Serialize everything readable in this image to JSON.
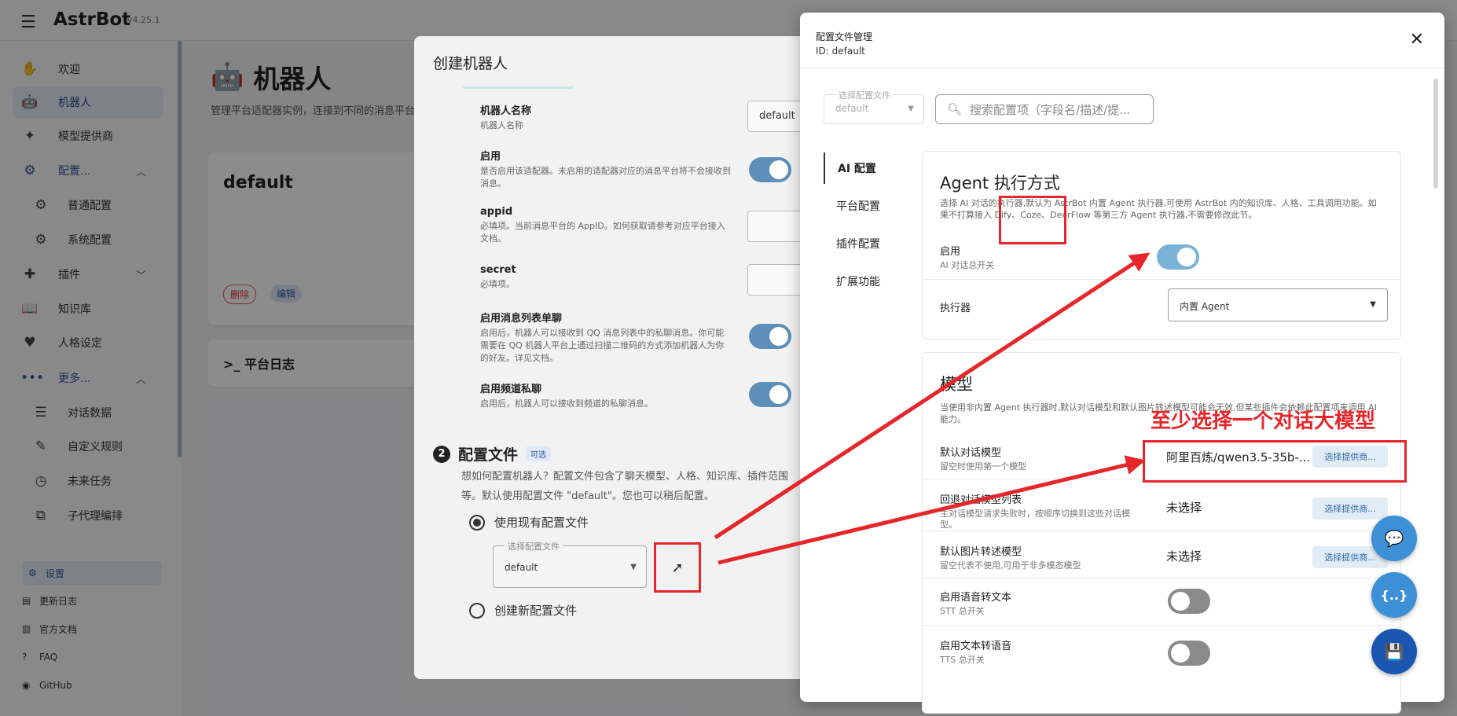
{
  "app": {
    "brand": "AstrBot",
    "version": "v4.25.1"
  },
  "sidebar": {
    "items": [
      {
        "label": "欢迎",
        "icon": "hand-wave-icon"
      },
      {
        "label": "机器人",
        "icon": "robot-icon"
      },
      {
        "label": "模型提供商",
        "icon": "sparkle-icon"
      },
      {
        "label": "配置...",
        "icon": "gear-icon"
      },
      {
        "label": "普通配置",
        "icon": "gear-icon"
      },
      {
        "label": "系统配置",
        "icon": "gear-outline-icon"
      },
      {
        "label": "插件",
        "icon": "puzzle-icon"
      },
      {
        "label": "知识库",
        "icon": "book-icon"
      },
      {
        "label": "人格设定",
        "icon": "heart-icon"
      },
      {
        "label": "更多...",
        "icon": "dots-icon"
      },
      {
        "label": "对话数据",
        "icon": "database-icon"
      },
      {
        "label": "自定义规则",
        "icon": "magic-wand-icon"
      },
      {
        "label": "未来任务",
        "icon": "clock-icon"
      },
      {
        "label": "子代理编排",
        "icon": "flow-icon"
      }
    ],
    "bottom": [
      {
        "label": "设置",
        "icon": "gear-icon"
      },
      {
        "label": "更新日志",
        "icon": "doc-icon"
      },
      {
        "label": "官方文档",
        "icon": "book-icon"
      },
      {
        "label": "FAQ",
        "icon": "help-icon"
      },
      {
        "label": "GitHub",
        "icon": "github-icon"
      }
    ]
  },
  "main": {
    "title": "机器人",
    "desc": "管理平台适配器实例，连接到不同的消息平台",
    "bot_name": "default",
    "delete_label": "删除",
    "edit_label": "编辑",
    "log_title": "平台日志"
  },
  "create_dialog": {
    "title": "创建机器人",
    "fields": [
      {
        "label": "机器人名称",
        "hint": "机器人名称",
        "value": "default"
      },
      {
        "label": "启用",
        "hint": "是否启用该适配器。未启用的适配器对应的消息平台将不会接收到消息。"
      },
      {
        "label": "appid",
        "hint": "必填项。当前消息平台的 AppID。如何获取请参考对应平台接入文档。"
      },
      {
        "label": "secret",
        "hint": "必填项。"
      },
      {
        "label": "启用消息列表单聊",
        "hint": "启用后，机器人可以接收到 QQ 消息列表中的私聊消息。你可能需要在 QQ 机器人平台上通过扫描二维码的方式添加机器人为你的好友。详见文档。"
      },
      {
        "label": "启用频道私聊",
        "hint": "启用后，机器人可以接收到频道的私聊消息。"
      }
    ],
    "section": {
      "num": "2",
      "title": "配置文件",
      "badge": "可选",
      "desc": "想如何配置机器人？配置文件包含了聊天模型、人格、知识库、插件范围等。默认使用配置文件 \"default\"。您也可以稍后配置。",
      "opt_existing": "使用现有配置文件",
      "select_legend": "选择配置文件",
      "select_value": "default",
      "opt_new": "创建新配置文件"
    }
  },
  "config_panel": {
    "title": "配置文件管理",
    "id_label": "ID: default",
    "select_legend": "选择配置文件",
    "select_value": "default",
    "search_placeholder": "搜索配置项（字段名/描述/提...",
    "tabs": [
      "AI 配置",
      "平台配置",
      "插件配置",
      "扩展功能"
    ],
    "agent": {
      "title": "Agent 执行方式",
      "desc": "选择 AI 对话的执行器,默认为 AstrBot 内置 Agent 执行器,可使用 AstrBot 内的知识库、人格、工具调用功能。如果不打算接入 Dify、Coze、DeerFlow 等第三方 Agent 执行器,不需要修改此节。",
      "enable_label": "启用",
      "enable_sub": "AI 对话总开关",
      "executor_label": "执行器",
      "executor_value": "内置 Agent"
    },
    "model": {
      "title": "模型",
      "desc": "当使用非内置 Agent 执行器时,默认对话模型和默认图片转述模型可能会无效,但某些插件会依赖此配置项来调用 AI 能力。",
      "rows": [
        {
          "label": "默认对话模型",
          "sub": "留空时使用第一个模型",
          "value": "阿里百炼/qwen3.5-35b-...",
          "btn": "选择提供商..."
        },
        {
          "label": "回退对话模型列表",
          "sub": "主对话模型请求失败时，按顺序切换到这些对话模型。",
          "value": "未选择",
          "btn": "选择提供商..."
        },
        {
          "label": "默认图片转述模型",
          "sub": "留空代表不使用,可用于非多模态模型",
          "value": "未选择",
          "btn": "选择提供商..."
        },
        {
          "label": "启用语音转文本",
          "sub": "STT 总开关"
        },
        {
          "label": "启用文本转语音",
          "sub": "TTS 总开关"
        }
      ]
    },
    "annotation": "至少选择一个对话大模型"
  },
  "fabs": [
    {
      "icon": "chat-icon",
      "glyph": "💬"
    },
    {
      "icon": "braces-icon",
      "glyph": "{..}"
    },
    {
      "icon": "save-icon",
      "glyph": "💾"
    }
  ],
  "colors": {
    "accent": "#2c5aa0",
    "highlight": "#e5262a",
    "toggle_on": "#5d8fb8"
  }
}
